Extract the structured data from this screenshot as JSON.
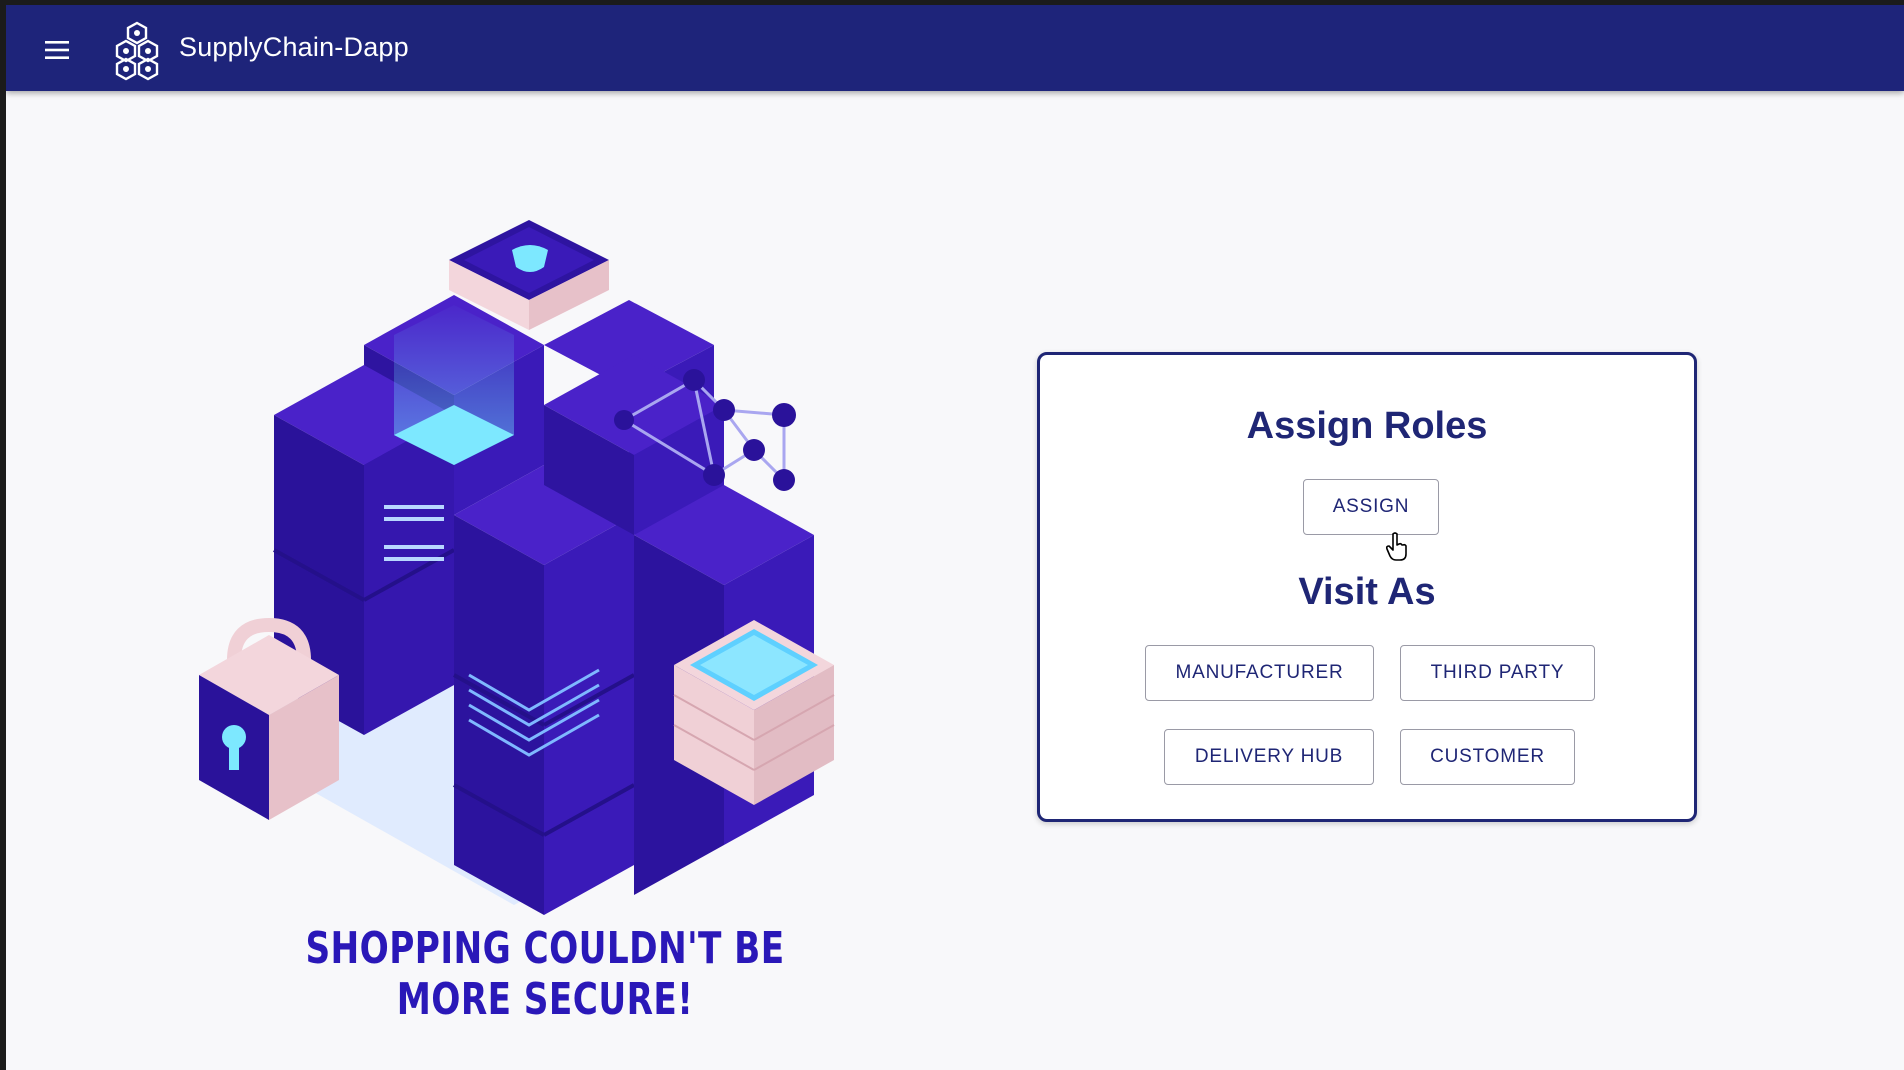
{
  "appbar": {
    "menu_icon": "menu-icon",
    "logo_icon": "hexagon-cluster-logo-icon",
    "title": "SupplyChain-Dapp",
    "background": "#1e247a"
  },
  "hero": {
    "tagline": "SHOPPING COULDN'T BE MORE SECURE!",
    "tagline_color": "#2a18b8"
  },
  "roles_card": {
    "assign_heading": "Assign Roles",
    "assign_button": "ASSIGN",
    "visit_heading": "Visit As",
    "visit_buttons": {
      "manufacturer": "MANUFACTURER",
      "third_party": "THIRD PARTY",
      "delivery_hub": "DELIVERY HUB",
      "customer": "CUSTOMER"
    },
    "accent": "#1f2675"
  }
}
